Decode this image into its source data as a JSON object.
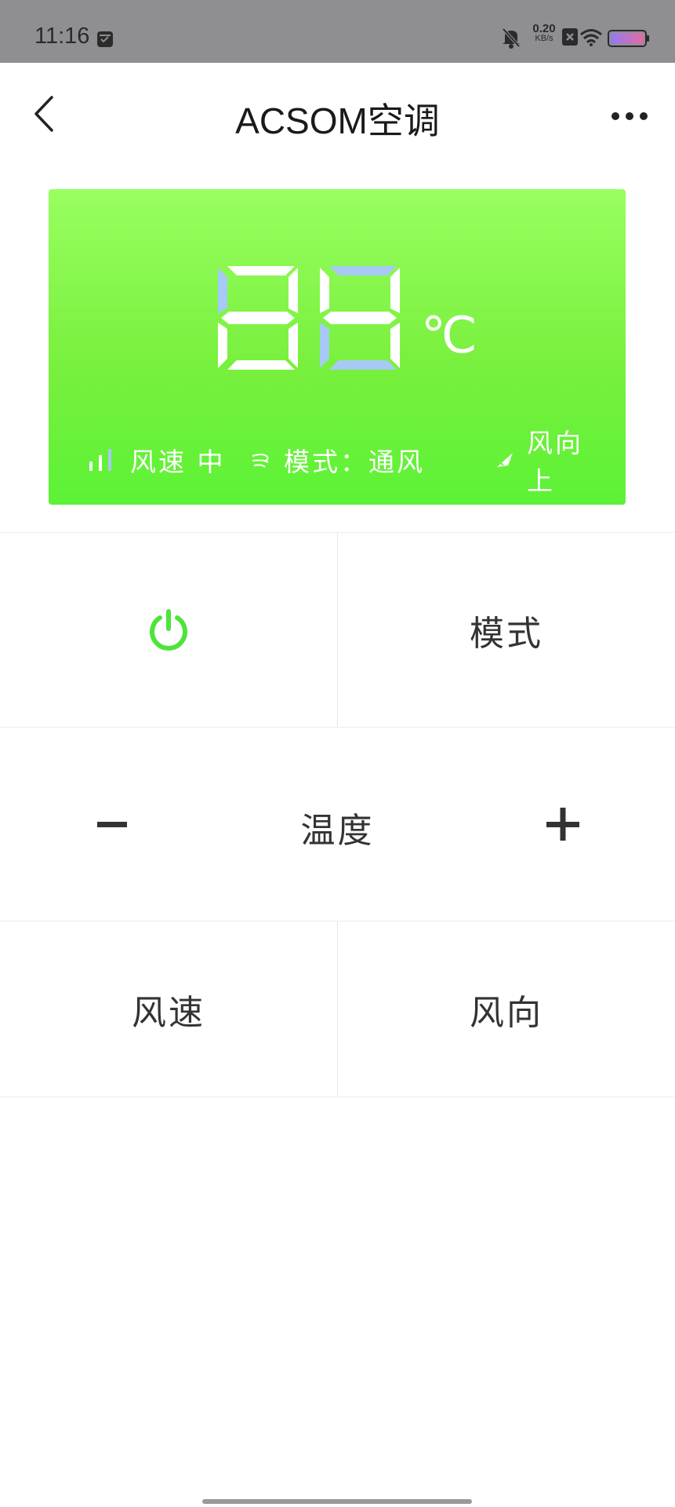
{
  "status_bar": {
    "time": "11:16",
    "net_speed_value": "0.20",
    "net_speed_unit": "KB/s",
    "icons": [
      "app-notification-icon",
      "mute-icon",
      "close-icon",
      "wifi-icon",
      "battery-icon"
    ]
  },
  "header": {
    "title": "ACSOM空调",
    "back_icon": "chevron-left-icon",
    "more_icon": "more-icon"
  },
  "display": {
    "temperature_digits": "88",
    "unit": "℃",
    "fan_speed": "风速 中",
    "mode": "模式：通风",
    "wind_direction": "风向 上",
    "colors": {
      "panel_top": "#98ff60",
      "panel_bottom": "#5cf236",
      "segment": "#ffffff",
      "segment_dim": "#a7c9f5"
    }
  },
  "controls": {
    "power_icon": "power-icon",
    "power_color": "#4fe33b",
    "mode_label": "模式",
    "temperature_label": "温度",
    "minus_icon": "minus-icon",
    "plus_icon": "plus-icon",
    "fan_speed_label": "风速",
    "wind_direction_label": "风向"
  }
}
